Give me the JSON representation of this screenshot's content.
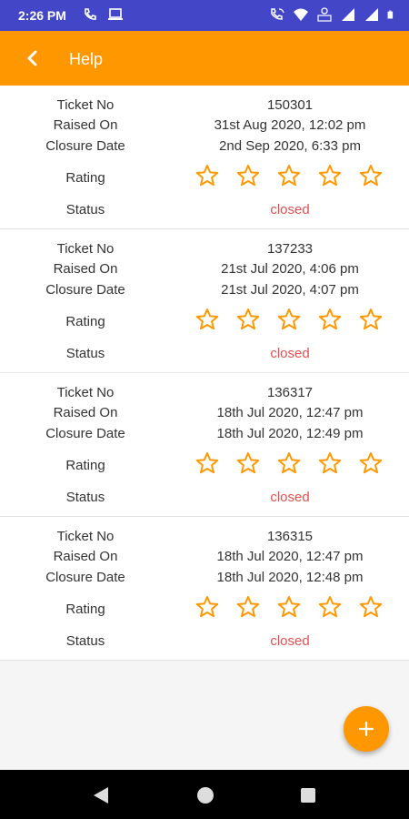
{
  "status_bar": {
    "time": "2:26 PM",
    "icons": [
      "phone-call-icon",
      "laptop-icon",
      "wifi-calling-icon",
      "wifi-icon",
      "volte-icon",
      "signal-icon",
      "signal-icon",
      "battery-icon"
    ]
  },
  "app_bar": {
    "title": "Help",
    "back_icon": "chevron-left-icon"
  },
  "labels": {
    "ticket_no": "Ticket No",
    "raised_on": "Raised On",
    "closure_date": "Closure Date",
    "rating": "Rating",
    "status": "Status"
  },
  "tickets": [
    {
      "ticket_no": "150301",
      "raised_on": "31st Aug 2020, 12:02 pm",
      "closure_date": "2nd Sep 2020, 6:33 pm",
      "rating": 0,
      "status": "closed"
    },
    {
      "ticket_no": "137233",
      "raised_on": "21st Jul 2020, 4:06 pm",
      "closure_date": "21st Jul 2020, 4:07 pm",
      "rating": 0,
      "status": "closed"
    },
    {
      "ticket_no": "136317",
      "raised_on": "18th Jul 2020, 12:47 pm",
      "closure_date": "18th Jul 2020, 12:49 pm",
      "rating": 0,
      "status": "closed"
    },
    {
      "ticket_no": "136315",
      "raised_on": "18th Jul 2020, 12:47 pm",
      "closure_date": "18th Jul 2020, 12:48 pm",
      "rating": 0,
      "status": "closed"
    }
  ],
  "max_rating": 5,
  "fab": {
    "icon": "plus-icon"
  },
  "nav_bar": {
    "icons": [
      "back-triangle-icon",
      "home-circle-icon",
      "recents-square-icon"
    ]
  },
  "colors": {
    "status_bar": "#4347c7",
    "accent": "#ff9800",
    "status_closed": "#e05050"
  }
}
